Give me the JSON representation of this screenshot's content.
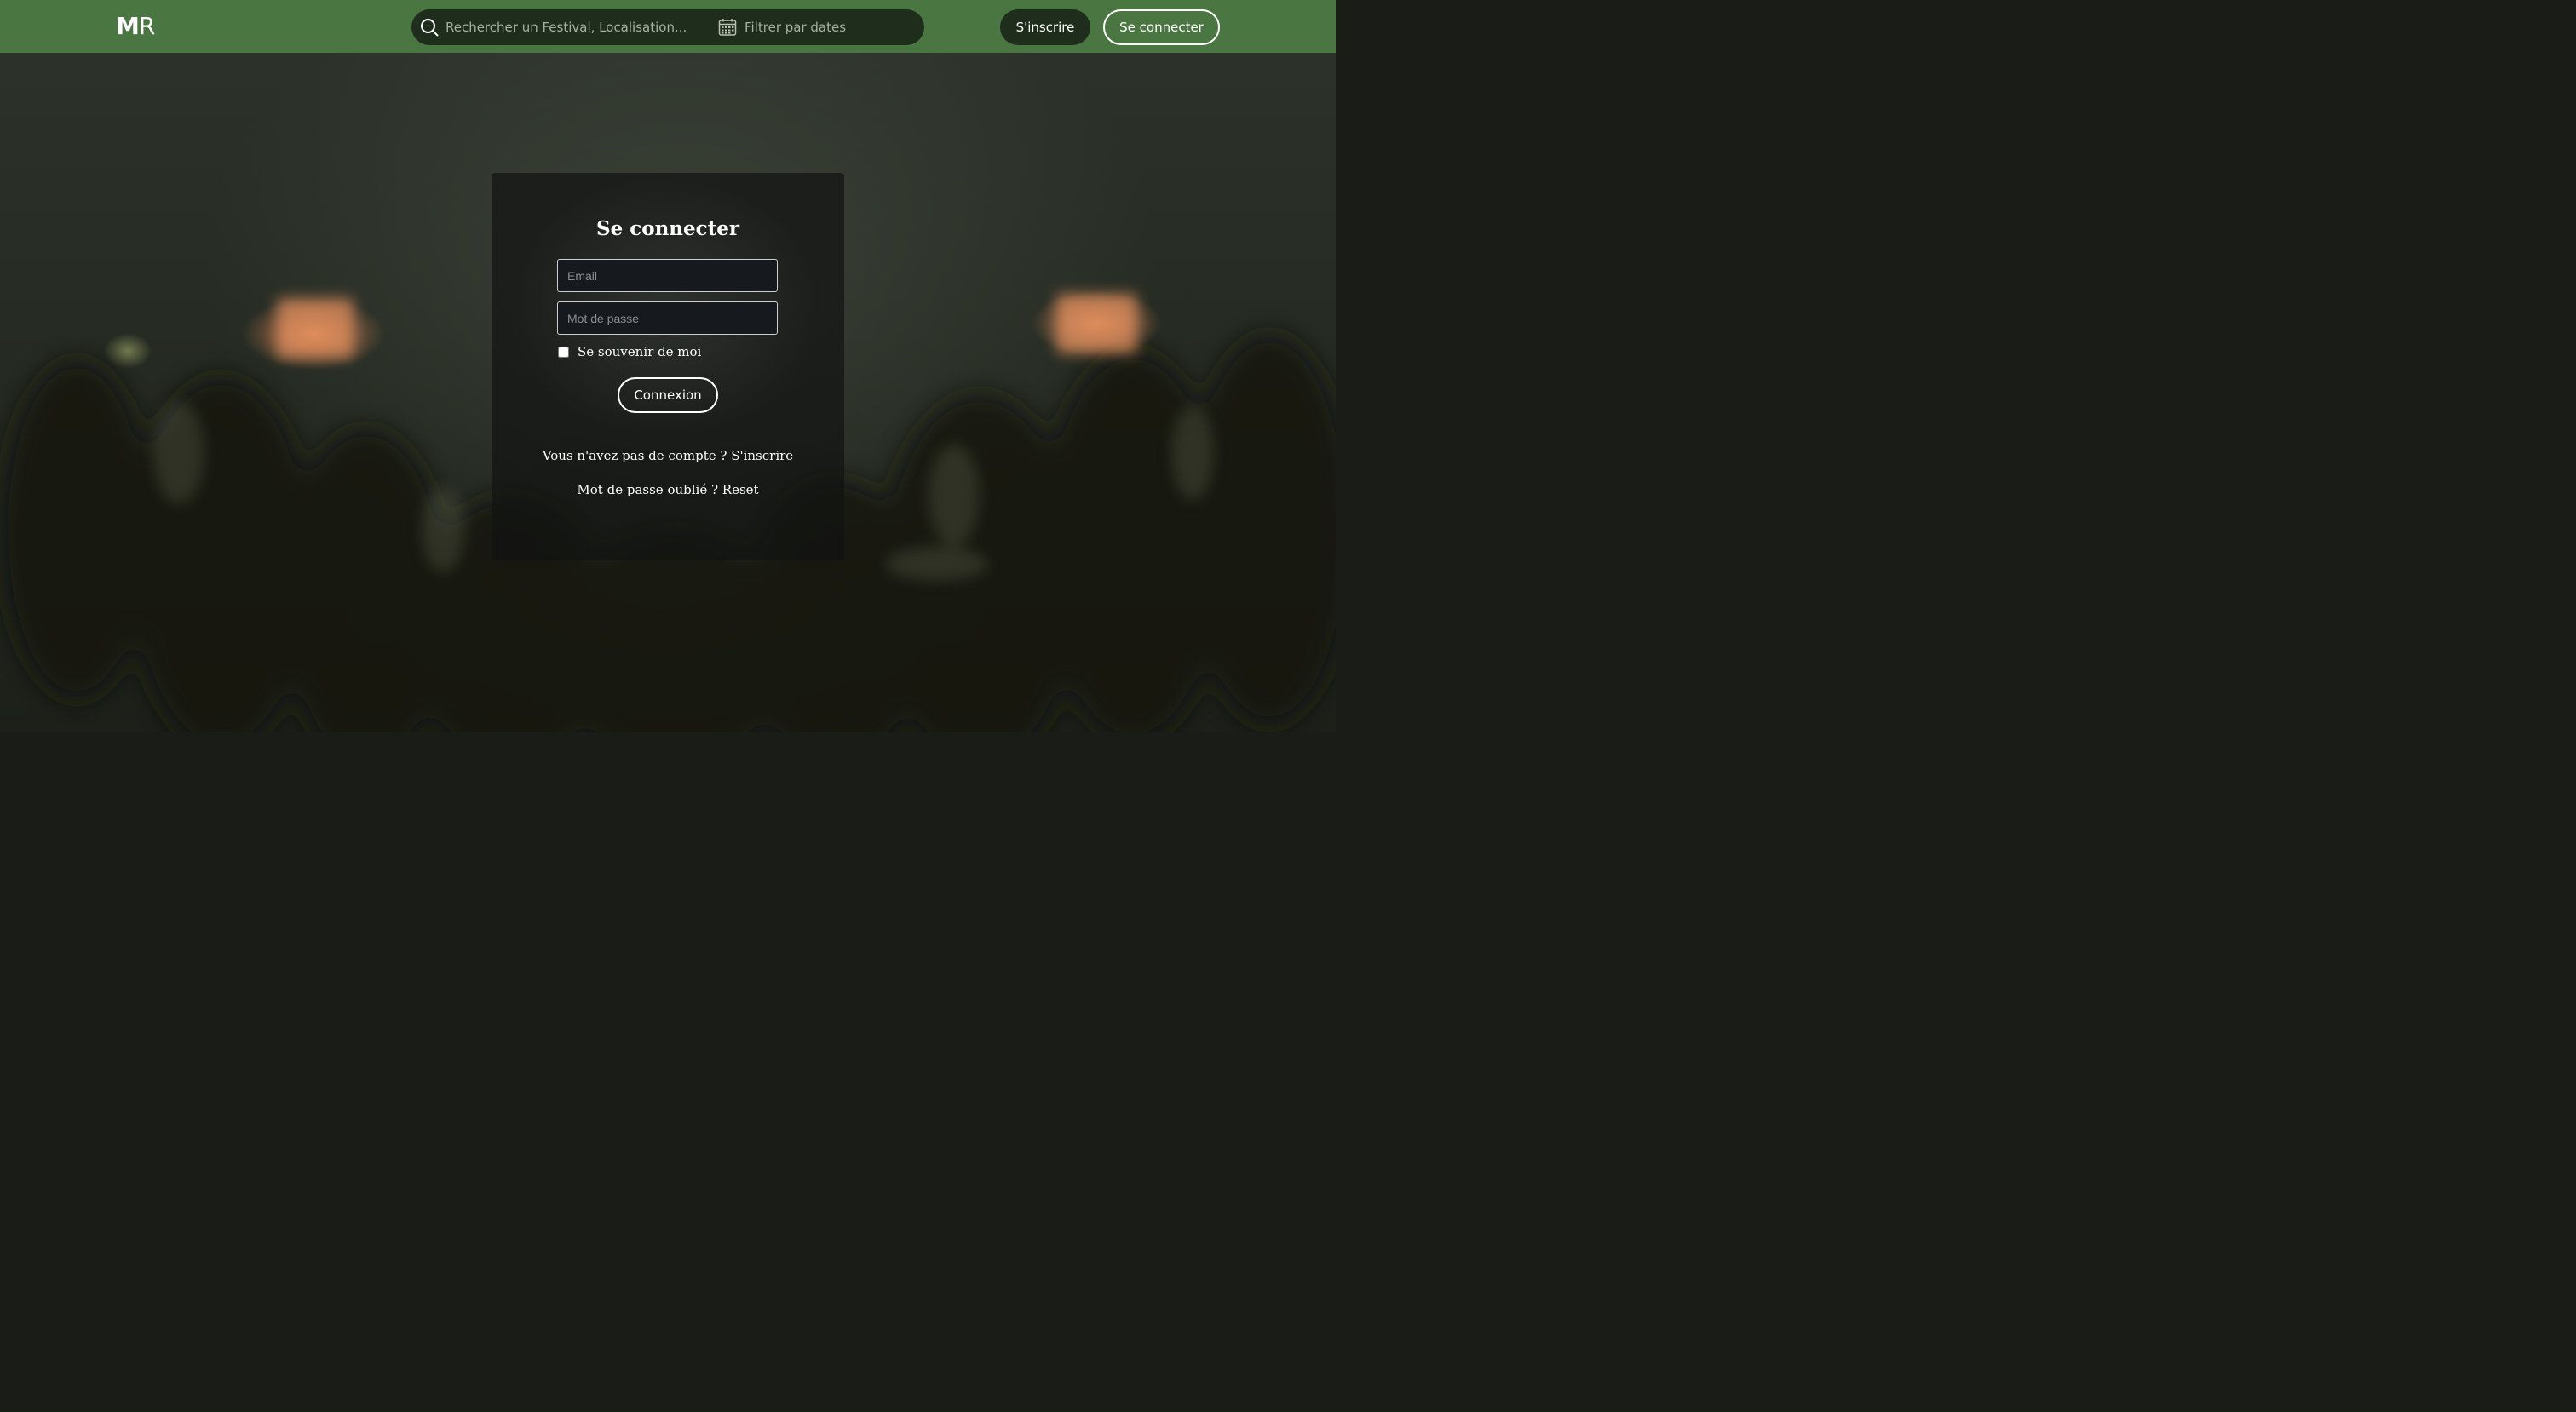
{
  "header": {
    "logo": {
      "bold": "M",
      "regular": "R"
    },
    "search": {
      "placeholder": "Rechercher un Festival, Localisation...",
      "icon": "search-icon"
    },
    "date_filter": {
      "placeholder": "Filtrer par dates",
      "icon": "calendar-icon"
    },
    "signup_label": "S'inscrire",
    "login_label": "Se connecter",
    "colors": {
      "bar": "#4a7641",
      "dark_pill": "#1f2d1c"
    }
  },
  "login_card": {
    "title": "Se connecter",
    "email_placeholder": "Email",
    "password_placeholder": "Mot de passe",
    "remember_label": "Se souvenir de moi",
    "remember_checked": false,
    "submit_label": "Connexion",
    "no_account_text": "Vous n'avez pas de compte ? ",
    "signup_link": "S'inscrire",
    "forgot_text": "Mot de passe oublié ? ",
    "reset_link": "Reset"
  }
}
